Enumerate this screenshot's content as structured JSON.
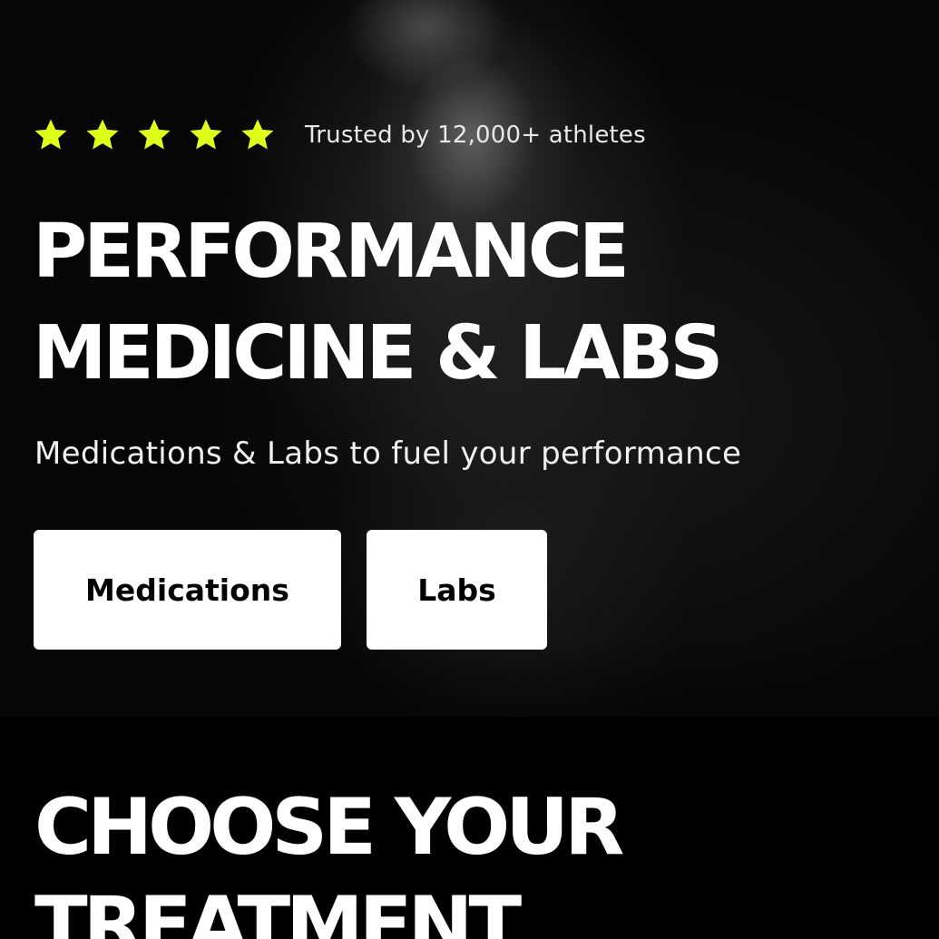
{
  "hero": {
    "stars": {
      "count": 5,
      "rating": 5,
      "color": "#dfff1a",
      "icon": "star-icon"
    },
    "trusted_text": "Trusted by 12,000+ athletes",
    "headline_line1": "PERFORMANCE",
    "headline_line2": "MEDICINE & LABS",
    "subheadline": "Medications & Labs to fuel your performance",
    "buttons": {
      "medications_label": "Medications",
      "labs_label": "Labs"
    }
  },
  "treatment_section": {
    "title_line1": "CHOOSE YOUR",
    "title_line2": "TREATMENT"
  },
  "colors": {
    "background": "#000000",
    "accent": "#dfff1a",
    "button_bg": "#ffffff",
    "button_text": "#000000"
  }
}
